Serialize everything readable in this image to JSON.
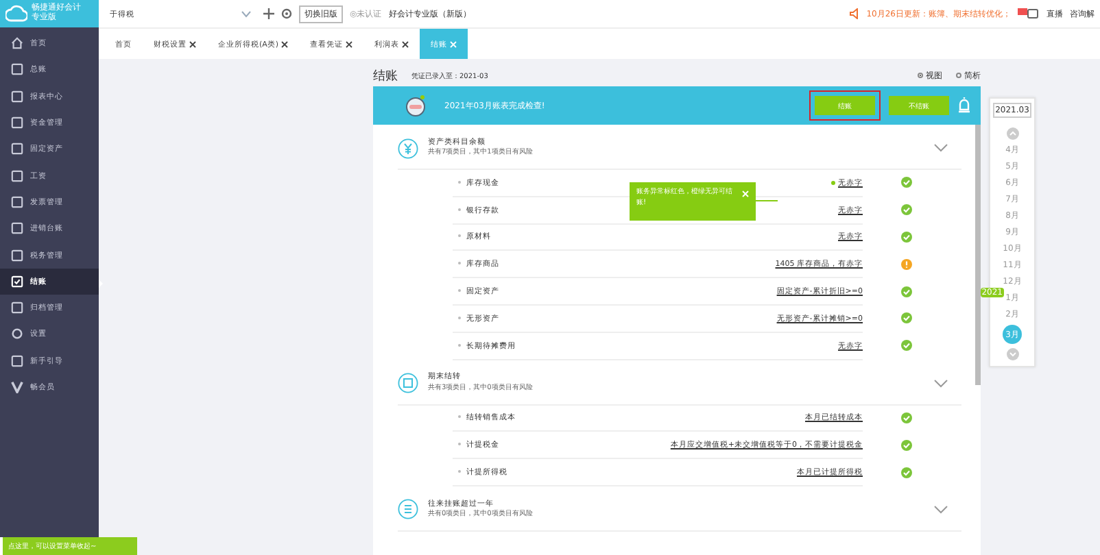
{
  "logo": {
    "name": "畅捷通好会计",
    "edition": "专业版"
  },
  "topbar": {
    "company": "于得税",
    "switch_button": "切换旧版",
    "auth": "◎未认证",
    "product": "好会计专业版（新版）",
    "notice": "10月26日更新：账簿、期末结转优化；",
    "live": "直播",
    "help": "咨询解"
  },
  "sidebar": {
    "items": [
      {
        "label": "首页",
        "selected": false
      },
      {
        "label": "总账",
        "selected": false
      },
      {
        "label": "报表中心",
        "selected": false
      },
      {
        "label": "资金管理",
        "selected": false
      },
      {
        "label": "固定资产",
        "selected": false
      },
      {
        "label": "工资",
        "selected": false
      },
      {
        "label": "发票管理",
        "selected": false
      },
      {
        "label": "进销台账",
        "selected": false
      },
      {
        "label": "税务管理",
        "selected": false
      },
      {
        "label": "结账",
        "selected": true
      },
      {
        "label": "归档管理",
        "selected": false
      },
      {
        "label": "设置",
        "selected": false
      },
      {
        "label": "新手引导",
        "selected": false
      },
      {
        "label": "畅会员",
        "selected": false
      }
    ],
    "hint": "点这里，可以设置菜单收起~"
  },
  "tabs": [
    {
      "label": "首页",
      "closable": false,
      "selected": false
    },
    {
      "label": "财税设置",
      "closable": true,
      "selected": false
    },
    {
      "label": "企业所得税(A类)",
      "closable": true,
      "selected": false
    },
    {
      "label": "查看凭证",
      "closable": true,
      "selected": false
    },
    {
      "label": "利润表",
      "closable": true,
      "selected": false
    },
    {
      "label": "结账",
      "closable": true,
      "selected": true
    }
  ],
  "page": {
    "title": "结账",
    "entered": "凭证已录入至：2021-03",
    "views": [
      {
        "label": "视图",
        "selected": true
      },
      {
        "label": "简析",
        "selected": false
      }
    ],
    "banner": {
      "message": "2021年03月账表完成检查!",
      "close_button": "结账",
      "skip_button": "不结账"
    },
    "tooltip": "账务异常标红色，橙绿无异可结账!",
    "sections": [
      {
        "title": "资产类科目余额",
        "summary": "共有7项类目，其中1项类目有风险",
        "items": [
          {
            "name": "库存现金",
            "result": "无赤字",
            "kind": "ok"
          },
          {
            "name": "银行存款",
            "result": "无赤字",
            "kind": "ok"
          },
          {
            "name": "原材料",
            "result": "无赤字",
            "kind": "ok"
          },
          {
            "name": "库存商品",
            "result": "1405 库存商品，有赤字",
            "kind": "warn"
          },
          {
            "name": "固定资产",
            "result": "固定资产-累计折旧>=0",
            "kind": "ok"
          },
          {
            "name": "无形资产",
            "result": "无形资产-累计摊销>=0",
            "kind": "ok"
          },
          {
            "name": "长期待摊费用",
            "result": "无赤字",
            "kind": "ok"
          }
        ]
      },
      {
        "title": "期末结转",
        "summary": "共有3项类目，其中0项类目有风险",
        "items": [
          {
            "name": "结转销售成本",
            "result": "本月已结转成本",
            "kind": "ok"
          },
          {
            "name": "计提税金",
            "result": "本月应交增值税+未交增值税等于0，不需要计提税金",
            "kind": "ok"
          },
          {
            "name": "计提所得税",
            "result": "本月已计提所得税",
            "kind": "ok"
          }
        ]
      },
      {
        "title": "往来挂账超过一年",
        "summary": "共有0项类目，其中0项类目有风险"
      }
    ]
  },
  "timeline": {
    "current": "2021.03",
    "year_badge": "2021",
    "months": [
      {
        "label": "4月",
        "selected": false
      },
      {
        "label": "5月",
        "selected": false
      },
      {
        "label": "6月",
        "selected": false
      },
      {
        "label": "7月",
        "selected": false
      },
      {
        "label": "8月",
        "selected": false
      },
      {
        "label": "9月",
        "selected": false
      },
      {
        "label": "10月",
        "selected": false
      },
      {
        "label": "11月",
        "selected": false
      },
      {
        "label": "12月",
        "selected": false
      },
      {
        "label": "1月",
        "selected": false,
        "year_start": true
      },
      {
        "label": "2月",
        "selected": false
      },
      {
        "label": "3月",
        "selected": true
      }
    ]
  }
}
